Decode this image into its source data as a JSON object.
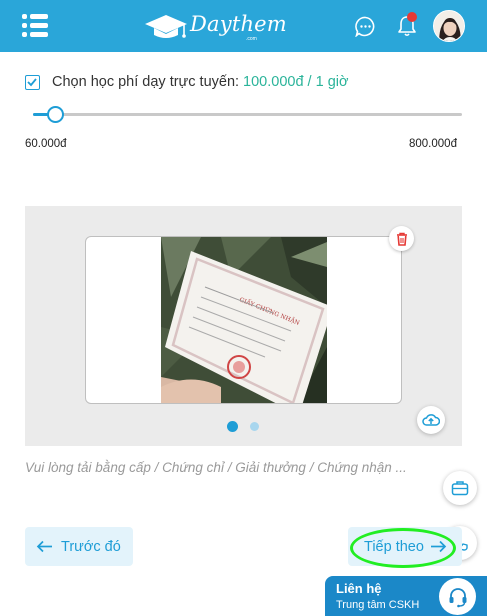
{
  "header": {
    "brand": "Daythem",
    "brand_sub": ".com",
    "menu_icon": "hamburger-menu-icon",
    "chat_icon": "chat-icon",
    "bell_icon": "bell-icon",
    "has_notification": true,
    "accent": "#2aa6d9"
  },
  "fee": {
    "checked": true,
    "label": "Chọn học phí dạy trực tuyến:",
    "value": "100.000đ / 1 giờ",
    "value_color": "#2bb49a"
  },
  "slider": {
    "min_label": "60.000đ",
    "max_label": "800.000đ",
    "level": 0.054
  },
  "upload": {
    "carousel_total": 2,
    "carousel_active": 1,
    "hint": "Vui lòng tải bằng cấp / Chứng chỉ / Giải thưởng / Chứng nhận ..."
  },
  "actions": {
    "prev_label": "Trước đó",
    "next_label": "Tiếp theo"
  },
  "contact": {
    "title": "Liên hệ",
    "subtitle": "Trung tâm CSKH"
  }
}
